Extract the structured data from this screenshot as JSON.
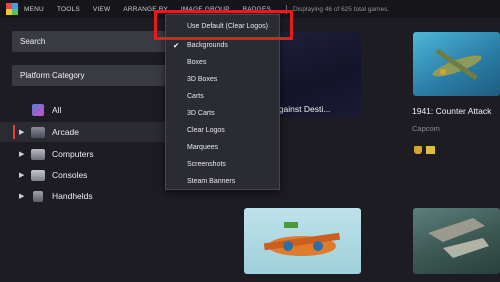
{
  "menubar": {
    "items": [
      "MENU",
      "TOOLS",
      "VIEW",
      "ARRANGE BY",
      "IMAGE GROUP",
      "BADGES"
    ],
    "status": "Displaying 46 of 625 total games."
  },
  "sidebar": {
    "search_label": "Search",
    "filter_label": "Platform Category",
    "tree": [
      {
        "label": "All",
        "icon": "all-platforms-icon",
        "has_caret": false,
        "selected": false
      },
      {
        "label": "Arcade",
        "icon": "arcade-icon",
        "has_caret": true,
        "selected": true
      },
      {
        "label": "Computers",
        "icon": "computer-icon",
        "has_caret": true,
        "selected": false
      },
      {
        "label": "Consoles",
        "icon": "console-icon",
        "has_caret": true,
        "selected": false
      },
      {
        "label": "Handhelds",
        "icon": "handheld-icon",
        "has_caret": true,
        "selected": false
      }
    ]
  },
  "dropdown": {
    "default_option": "Use Default (Clear Logos)",
    "options": [
      {
        "label": "Backgrounds",
        "checked": true
      },
      {
        "label": "Boxes",
        "checked": false
      },
      {
        "label": "3D Boxes",
        "checked": false
      },
      {
        "label": "Carts",
        "checked": false
      },
      {
        "label": "3D Carts",
        "checked": false
      },
      {
        "label": "Clear Logos",
        "checked": false
      },
      {
        "label": "Marquees",
        "checked": false
      },
      {
        "label": "Screenshots",
        "checked": false
      },
      {
        "label": "Steam Banners",
        "checked": false
      }
    ]
  },
  "games": [
    {
      "title": "War Against Desti...",
      "publisher": ""
    },
    {
      "title": "1941: Counter Attack",
      "publisher": "Capcom"
    }
  ],
  "colors": {
    "accent": "#e63c3c",
    "highlight_border": "#e41c1c",
    "badge_trophy": "#d4a62a",
    "badge_flag": "#d9c23a"
  }
}
